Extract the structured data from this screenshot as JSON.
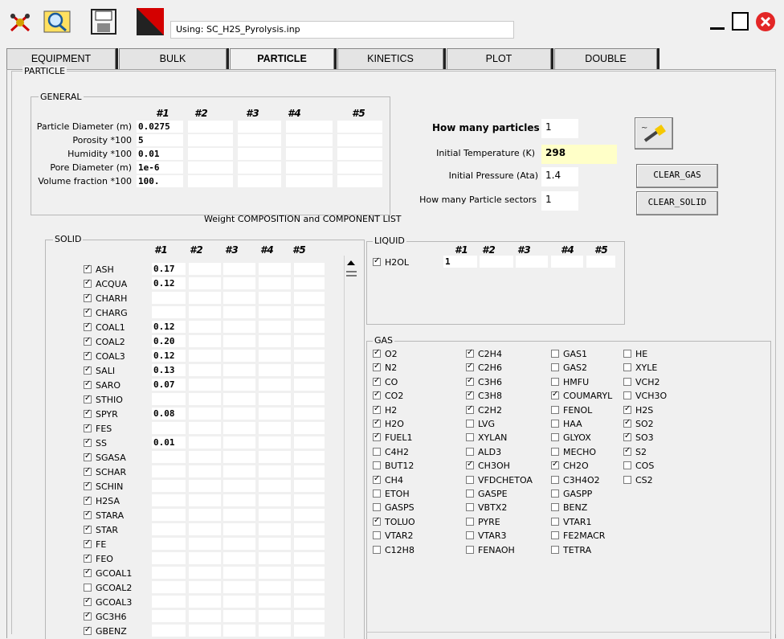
{
  "file_label": "Using: SC_H2S_Pyrolysis.inp",
  "toolbar": {
    "run_icon": "tools-icon",
    "open_icon": "folder-search-icon",
    "save_icon": "floppy-disk-icon",
    "logo_icon": "red-triangle-logo-icon"
  },
  "window": {
    "minimize": "minimize-icon",
    "maximize": "maximize-icon",
    "close": "close-icon"
  },
  "tabs": [
    "EQUIPMENT",
    "BULK",
    "PARTICLE",
    "KINETICS",
    "PLOT",
    "DOUBLE"
  ],
  "active_tab": "PARTICLE",
  "panel_title": "PARTICLE",
  "general": {
    "title": "GENERAL",
    "cols": [
      "#1",
      "#2",
      "#3",
      "#4",
      "#5"
    ],
    "rows": [
      {
        "label": "Particle Diameter (m)",
        "values": [
          "0.0275",
          "",
          "",
          "",
          ""
        ]
      },
      {
        "label": "Porosity  *100",
        "values": [
          "5",
          "",
          "",
          "",
          ""
        ]
      },
      {
        "label": "Humidity *100",
        "values": [
          "0.01",
          "",
          "",
          "",
          ""
        ]
      },
      {
        "label": "Pore Diameter (m)",
        "values": [
          "1e-6",
          "",
          "",
          "",
          ""
        ]
      },
      {
        "label": "Volume fraction *100",
        "values": [
          "100.",
          "",
          "",
          "",
          ""
        ]
      }
    ]
  },
  "settings": {
    "how_many_particles_label": "How many particles",
    "how_many_particles": "1",
    "initial_temp_label": "Initial Temperature (K)",
    "initial_temp": "298",
    "initial_pressure_label": "Initial Pressure (Ata)",
    "initial_pressure": "1.4",
    "sectors_label": "How many Particle sectors",
    "sectors": "1",
    "clear_gas": "CLEAR_GAS",
    "clear_solid": "CLEAR_SOLID",
    "wand_icon": "magic-wand-icon"
  },
  "composition_title": "Weight COMPOSITION and COMPONENT LIST",
  "solid": {
    "title": "SOLID",
    "cols": [
      "#1",
      "#2",
      "#3",
      "#4",
      "#5"
    ],
    "rows": [
      {
        "name": "ASH",
        "checked": true,
        "v1": "0.17"
      },
      {
        "name": "ACQUA",
        "checked": true,
        "v1": "0.12"
      },
      {
        "name": "CHARH",
        "checked": true,
        "v1": ""
      },
      {
        "name": "CHARG",
        "checked": true,
        "v1": ""
      },
      {
        "name": "COAL1",
        "checked": true,
        "v1": "0.12"
      },
      {
        "name": "COAL2",
        "checked": true,
        "v1": "0.20"
      },
      {
        "name": "COAL3",
        "checked": true,
        "v1": "0.12"
      },
      {
        "name": "SALI",
        "checked": true,
        "v1": "0.13"
      },
      {
        "name": "SARO",
        "checked": true,
        "v1": "0.07"
      },
      {
        "name": "STHIO",
        "checked": true,
        "v1": ""
      },
      {
        "name": "SPYR",
        "checked": true,
        "v1": "0.08"
      },
      {
        "name": "FES",
        "checked": true,
        "v1": ""
      },
      {
        "name": "SS",
        "checked": true,
        "v1": "0.01"
      },
      {
        "name": "SGASA",
        "checked": true,
        "v1": ""
      },
      {
        "name": "SCHAR",
        "checked": true,
        "v1": ""
      },
      {
        "name": "SCHIN",
        "checked": true,
        "v1": ""
      },
      {
        "name": "H2SA",
        "checked": true,
        "v1": ""
      },
      {
        "name": "STARA",
        "checked": true,
        "v1": ""
      },
      {
        "name": "STAR",
        "checked": true,
        "v1": ""
      },
      {
        "name": "FE",
        "checked": true,
        "v1": ""
      },
      {
        "name": "FEO",
        "checked": true,
        "v1": ""
      },
      {
        "name": "GCOAL1",
        "checked": true,
        "v1": ""
      },
      {
        "name": "GCOAL2",
        "checked": false,
        "v1": ""
      },
      {
        "name": "GCOAL3",
        "checked": true,
        "v1": ""
      },
      {
        "name": "GC3H6",
        "checked": true,
        "v1": ""
      },
      {
        "name": "GBENZ",
        "checked": true,
        "v1": ""
      }
    ]
  },
  "liquid": {
    "title": "LIQUID",
    "cols": [
      "#1",
      "#2",
      "#3",
      "#4",
      "#5"
    ],
    "rows": [
      {
        "name": "H2OL",
        "checked": true,
        "v1": "1"
      }
    ]
  },
  "gas": {
    "title": "GAS",
    "columns": [
      [
        {
          "n": "O2",
          "c": true
        },
        {
          "n": "N2",
          "c": true
        },
        {
          "n": "CO",
          "c": true
        },
        {
          "n": "CO2",
          "c": true
        },
        {
          "n": "H2",
          "c": true
        },
        {
          "n": "H2O",
          "c": true
        },
        {
          "n": "FUEL1",
          "c": true
        },
        {
          "n": "C4H2",
          "c": false
        },
        {
          "n": "BUT12",
          "c": false
        },
        {
          "n": "CH4",
          "c": true
        },
        {
          "n": "ETOH",
          "c": false
        },
        {
          "n": "GASPS",
          "c": false
        },
        {
          "n": "TOLUO",
          "c": true
        },
        {
          "n": "VTAR2",
          "c": false
        },
        {
          "n": "C12H8",
          "c": false
        }
      ],
      [
        {
          "n": "C2H4",
          "c": true
        },
        {
          "n": "C2H6",
          "c": true
        },
        {
          "n": "C3H6",
          "c": true
        },
        {
          "n": "C3H8",
          "c": true
        },
        {
          "n": "C2H2",
          "c": true
        },
        {
          "n": "LVG",
          "c": false
        },
        {
          "n": "XYLAN",
          "c": false
        },
        {
          "n": "ALD3",
          "c": false
        },
        {
          "n": "CH3OH",
          "c": true
        },
        {
          "n": "VFDCHETOA",
          "c": false
        },
        {
          "n": "GASPE",
          "c": false
        },
        {
          "n": "VBTX2",
          "c": false
        },
        {
          "n": "PYRE",
          "c": false
        },
        {
          "n": "VTAR3",
          "c": false
        },
        {
          "n": "FENAOH",
          "c": false
        }
      ],
      [
        {
          "n": "GAS1",
          "c": false
        },
        {
          "n": "GAS2",
          "c": false
        },
        {
          "n": "HMFU",
          "c": false
        },
        {
          "n": "COUMARYL",
          "c": true
        },
        {
          "n": "FENOL",
          "c": false
        },
        {
          "n": "HAA",
          "c": false
        },
        {
          "n": "GLYOX",
          "c": false
        },
        {
          "n": "MECHO",
          "c": false
        },
        {
          "n": "CH2O",
          "c": true
        },
        {
          "n": "C3H4O2",
          "c": false
        },
        {
          "n": "GASPP",
          "c": false
        },
        {
          "n": "BENZ",
          "c": false
        },
        {
          "n": "VTAR1",
          "c": false
        },
        {
          "n": "FE2MACR",
          "c": false
        },
        {
          "n": "TETRA",
          "c": false
        }
      ],
      [
        {
          "n": "HE",
          "c": false
        },
        {
          "n": "XYLE",
          "c": false
        },
        {
          "n": "VCH2",
          "c": false
        },
        {
          "n": "VCH3O",
          "c": false
        },
        {
          "n": "H2S",
          "c": true
        },
        {
          "n": "SO2",
          "c": true
        },
        {
          "n": "SO3",
          "c": true
        },
        {
          "n": "S2",
          "c": true
        },
        {
          "n": "COS",
          "c": false
        },
        {
          "n": "CS2",
          "c": false
        }
      ]
    ]
  }
}
